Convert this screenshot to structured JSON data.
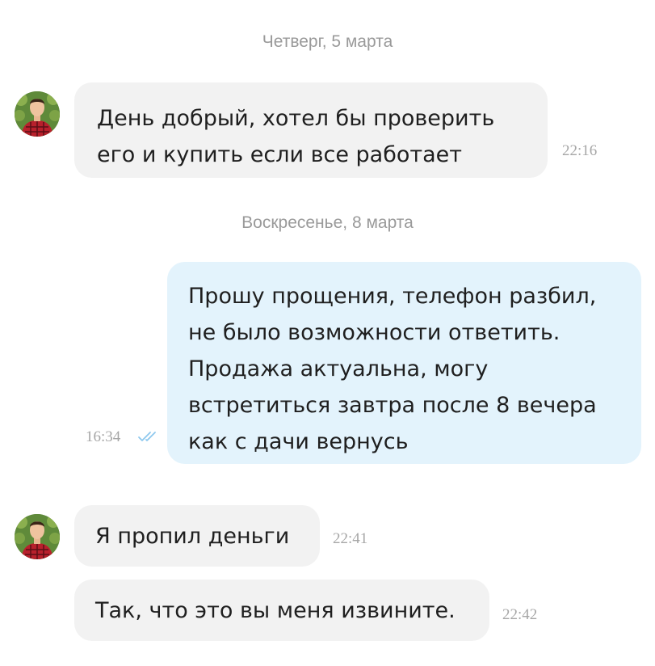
{
  "chat": {
    "date_separators": [
      "Четверг, 5 марта",
      "Воскресенье, 8 марта"
    ],
    "messages": [
      {
        "direction": "incoming",
        "lines": [
          "День добрый, хотел бы проверить",
          "его и купить если все работает"
        ],
        "time": "22:16"
      },
      {
        "direction": "outgoing",
        "lines": [
          "Прошу прощения, телефон разбил,",
          "не было возможности ответить.",
          "Продажа актуальна, могу",
          "встретиться завтра после 8 вечера",
          "как с дачи вернусь"
        ],
        "time": "16:34",
        "read_status": "read-double-check-icon"
      },
      {
        "direction": "incoming",
        "lines": [
          "Я пропил деньги"
        ],
        "time": "22:41"
      },
      {
        "direction": "incoming",
        "lines": [
          "Так, что это вы меня извините."
        ],
        "time": "22:42"
      }
    ]
  },
  "colors": {
    "incoming_bubble": "#f2f2f2",
    "outgoing_bubble": "#e3f3fc",
    "read_check": "#8ec8ee",
    "muted_text": "#9a9a9a"
  },
  "icons": {
    "avatar": "user-avatar",
    "read_status": "double-check-icon"
  }
}
